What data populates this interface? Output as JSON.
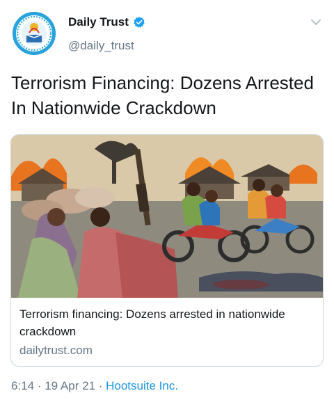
{
  "account": {
    "name": "Daily Trust",
    "handle": "@daily_trust",
    "avatar_icon": "daily-trust-logo",
    "verified_icon": "verified-badge-icon"
  },
  "tweet": {
    "text": "Terrorism Financing: Dozens Arrested In Nationwide Crackdown"
  },
  "card": {
    "image_icon": "illustration-armed-men-on-motorcycles-burning-village",
    "title": "Terrorism financing: Dozens arrested in nationwide crackdown",
    "domain": "dailytrust.com"
  },
  "meta": {
    "time": "6:14",
    "sep1": " · ",
    "date": "19 Apr 21",
    "sep2": " · ",
    "source": "Hootsuite Inc."
  },
  "colors": {
    "accent": "#1b95e0",
    "secondary_text": "#657786",
    "verified": "#1da1f2"
  }
}
